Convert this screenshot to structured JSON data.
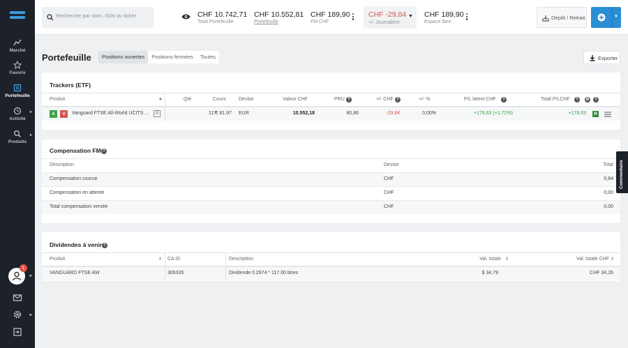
{
  "sidebar": {
    "items": [
      {
        "label": "Marché"
      },
      {
        "label": "Favoris"
      },
      {
        "label": "Portefeuille"
      },
      {
        "label": "Activité"
      },
      {
        "label": "Produits"
      }
    ],
    "notification_count": "1"
  },
  "topbar": {
    "search_placeholder": "Recherche par nom, ISIN ou ticker",
    "stats": [
      {
        "value": "CHF 10.742,71",
        "label": "Total Portefeuille"
      },
      {
        "value": "CHF 10.552,81",
        "label": "Portefeuille"
      },
      {
        "value": "CHF 189,90",
        "label": "FM CHF"
      },
      {
        "value": "CHF -29,84",
        "label": "+/- Journalière"
      },
      {
        "value": "CHF 189,90",
        "label": "Espace libre"
      }
    ],
    "depot_label": "Dépôt / Retrait"
  },
  "page": {
    "title": "Portefeuille",
    "tabs": [
      "Positions ouvertes",
      "Positions fermées",
      "Toutes"
    ],
    "export_label": "Exporter"
  },
  "trackers": {
    "title": "Trackers (ETF)",
    "headers": [
      "Produit",
      "Qté",
      "Cours",
      "Devise",
      "Valeur CHF",
      "PRU",
      "+/- CHF",
      "+/- %",
      "P/L latent CHF",
      "Total P/LCHF"
    ],
    "row": {
      "badge_a": "A",
      "badge_v": "V",
      "product": "Vanguard FTSE All-World UCITS ...",
      "badge_g": "G",
      "qty": "117",
      "price": "€ 81,97",
      "currency": "EUR",
      "value": "10.552,18",
      "pru": "80,86",
      "pl_chf": "-29,84",
      "pl_pct": "0,00%",
      "latent": "+178,63 (+1,72%)",
      "total": "+178,63",
      "badge_r": "R"
    }
  },
  "compensation": {
    "title": "Compensation FM",
    "headers": [
      "Description",
      "Devise",
      "Total"
    ],
    "rows": [
      {
        "desc": "Compensation courue",
        "cur": "CHF",
        "total": "0,64"
      },
      {
        "desc": "Compensation en attente",
        "cur": "CHF",
        "total": "0,00"
      },
      {
        "desc": "Total compensation versée",
        "cur": "CHF",
        "total": "0,00"
      }
    ]
  },
  "dividends": {
    "title": "Dividendes à venir",
    "headers": [
      "Produit",
      "CA ID",
      "Description",
      "Val. totale",
      "Val. totale CHF"
    ],
    "row": {
      "product": "VANGUARD FTSE AW",
      "ca_id": "306335",
      "desc": "Dividende 0.2974 * 117.00 titres",
      "total": "$ 34,79",
      "total_chf": "CHF 34,26"
    }
  },
  "side_tab": "Commentaire",
  "colors": {
    "accent": "#2a8ed4",
    "negative": "#d9534f",
    "positive": "#3aa14a",
    "sidebar": "#1d2129"
  }
}
